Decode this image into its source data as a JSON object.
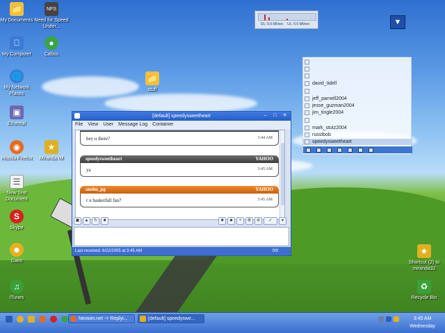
{
  "desktop": {
    "icons": [
      {
        "label": "My Documents",
        "icon": "folder-icon",
        "color": "#f0c040"
      },
      {
        "label": "Need for Speed Under...",
        "icon": "game-icon",
        "color": "#444444"
      },
      {
        "label": "My Computer",
        "icon": "computer-icon",
        "color": "#3a7bd5"
      },
      {
        "label": "Cabos",
        "icon": "cabos-icon",
        "color": "#3ba34a"
      },
      {
        "label": "My Network Places",
        "icon": "network-icon",
        "color": "#3a7bd5"
      },
      {
        "label": "Ethereal",
        "icon": "ethereal-icon",
        "color": "#6a6ab0"
      },
      {
        "label": "Mozilla Firefox",
        "icon": "firefox-icon",
        "color": "#e66a1e"
      },
      {
        "label": "Miranda IM",
        "icon": "miranda-icon",
        "color": "#e0b020"
      },
      {
        "label": "New Text Document",
        "icon": "text-file-icon",
        "color": "#f2f2f2"
      },
      {
        "label": "Skype",
        "icon": "skype-icon",
        "color": "#d82020"
      },
      {
        "label": "Gaim",
        "icon": "gaim-icon",
        "color": "#e8b020"
      },
      {
        "label": "iTunes",
        "icon": "itunes-icon",
        "color": "#3aa03a"
      },
      {
        "label": "stuff",
        "icon": "folder-icon",
        "color": "#f0c040"
      },
      {
        "label": "Shortcut (2) to miranda32",
        "icon": "miranda-icon",
        "color": "#e0b020"
      },
      {
        "label": "Recycle Bin",
        "icon": "recycle-bin-icon",
        "color": "#3aa03a"
      }
    ]
  },
  "netmeter": {
    "down": "DL: 0.0 kB/sec",
    "up": "UL: 0.0 kB/sec"
  },
  "chat_window": {
    "title": "[default] speedysweetheart",
    "menu": [
      "File",
      "View",
      "User",
      "Message Log",
      "Container"
    ],
    "messages": [
      {
        "sender": "",
        "protocol": "",
        "text": "hey u there?",
        "time": "3:44 AM",
        "style": "gray"
      },
      {
        "sender": "speedysweetheart",
        "protocol": "YAHOO",
        "text": "ya",
        "time": "3:45 AM",
        "style": "gray"
      },
      {
        "sender": "anshu_pg",
        "protocol": "YAHOO",
        "text": "r u basketfall fan?",
        "time": "3:45 AM",
        "style": "orange"
      }
    ],
    "input_value": "",
    "status_left": "Last received: 6/22/2005 at 3:45 AM",
    "status_count": "0/0"
  },
  "contact_list": {
    "contacts": [
      "david_tidell",
      "jeff_parnell2004",
      "jesse_guzman2004",
      "jim_tingle2004",
      "mark_stutz2004",
      "russtbob",
      "speedysweetheart"
    ],
    "selected": "speedysweetheart"
  },
  "taskbar": {
    "tasks": [
      "Neowin.net -> Replyi...",
      "[default] speedyswe..."
    ],
    "clock_time": "3:45 AM",
    "clock_day": "Wednesday"
  }
}
